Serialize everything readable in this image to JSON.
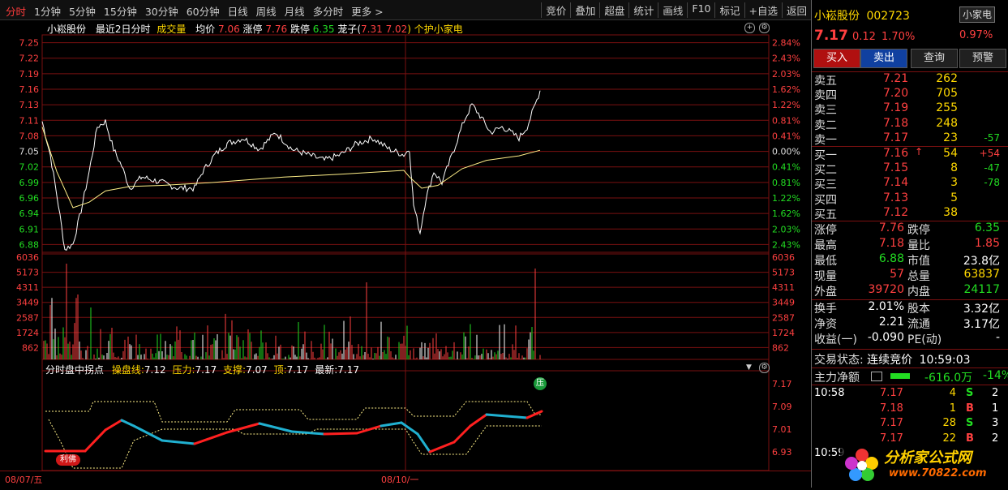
{
  "toolbar": {
    "periods": [
      "分时",
      "1分钟",
      "5分钟",
      "15分钟",
      "30分钟",
      "60分钟",
      "日线",
      "周线",
      "月线",
      "多分时",
      "更多 >"
    ],
    "tools": [
      "竞价",
      "叠加",
      "超盘",
      "统计",
      "画线",
      "F10",
      "标记",
      "+自选",
      "返回"
    ]
  },
  "chart_info": {
    "name": "小崧股份",
    "mode": "最近2日分时",
    "vol_label": "成交量",
    "avg_label": "均价",
    "avg": "7.06",
    "limit_up_label": "涨停",
    "limit_up": "7.76",
    "limit_down_label": "跌停",
    "limit_down": "6.35",
    "extra_label": "茏子(",
    "extra1": "7.31",
    "extra2": "7.02",
    "extra_tail": ") 个护小家电"
  },
  "axes": {
    "price_ticks": [
      "7.25",
      "7.22",
      "7.19",
      "7.16",
      "7.13",
      "7.11",
      "7.08",
      "7.05",
      "7.02",
      "6.99",
      "6.96",
      "6.94",
      "6.91",
      "6.88"
    ],
    "pct_ticks": [
      "2.84%",
      "2.43%",
      "2.03%",
      "1.62%",
      "1.22%",
      "0.81%",
      "0.41%",
      "0.00%",
      "0.41%",
      "0.81%",
      "1.22%",
      "1.62%",
      "2.03%",
      "2.43%"
    ],
    "vol_ticks": [
      "6036",
      "5173",
      "4311",
      "3449",
      "2587",
      "1724",
      "862"
    ],
    "ind_ticks": [
      "7.17",
      "7.09",
      "7.01",
      "6.93"
    ],
    "dates": [
      "08/07/五",
      "08/10/一"
    ]
  },
  "indicator": {
    "title": "分时盘中拐点",
    "line_label": "操盘线:",
    "line_value": "7.12",
    "pressure_label": "压力:",
    "pressure_value": "7.17",
    "support_label": "支撑:",
    "support_value": "7.07",
    "top_label": "顶:",
    "top_value": "7.17",
    "latest_label": "最新:",
    "latest_value": "7.17",
    "badge_buy": "利佛",
    "badge_pressure": "压"
  },
  "chart_data": {
    "type": "line",
    "series": [],
    "ylim": [
      6.88,
      7.25
    ],
    "grid": true
  },
  "panel": {
    "stock_name": "小崧股份",
    "stock_code": "002723",
    "sector": "小家电",
    "sector_pct": "0.97%",
    "price": "7.17",
    "change": "0.12",
    "change_pct": "1.70%",
    "buttons": [
      "买入",
      "卖出",
      "查询",
      "预警"
    ],
    "asks": [
      {
        "label": "卖五",
        "price": "7.21",
        "vol": "262",
        "diff": ""
      },
      {
        "label": "卖四",
        "price": "7.20",
        "vol": "705",
        "diff": ""
      },
      {
        "label": "卖三",
        "price": "7.19",
        "vol": "255",
        "diff": ""
      },
      {
        "label": "卖二",
        "price": "7.18",
        "vol": "248",
        "diff": ""
      },
      {
        "label": "卖一",
        "price": "7.17",
        "vol": "23",
        "diff": "-57"
      }
    ],
    "bids": [
      {
        "label": "买一",
        "price": "7.16",
        "vol": "54",
        "diff": "+54"
      },
      {
        "label": "买二",
        "price": "7.15",
        "vol": "8",
        "diff": "-47"
      },
      {
        "label": "买三",
        "price": "7.14",
        "vol": "3",
        "diff": "-78"
      },
      {
        "label": "买四",
        "price": "7.13",
        "vol": "5",
        "diff": ""
      },
      {
        "label": "买五",
        "price": "7.12",
        "vol": "38",
        "diff": ""
      }
    ],
    "stats": [
      {
        "l1": "涨停",
        "v1": "7.76",
        "l2": "跌停",
        "v2": "6.35"
      },
      {
        "l1": "最高",
        "v1": "7.18",
        "l2": "量比",
        "v2": "1.85"
      },
      {
        "l1": "最低",
        "v1": "6.88",
        "l2": "市值",
        "v2": "23.8亿"
      },
      {
        "l1": "现量",
        "v1": "57",
        "l2": "总量",
        "v2": "63837"
      },
      {
        "l1": "外盘",
        "v1": "39720",
        "l2": "内盘",
        "v2": "24117"
      }
    ],
    "stats2": [
      {
        "l1": "换手",
        "v1": "2.01%",
        "l2": "股本",
        "v2": "3.32亿"
      },
      {
        "l1": "净资",
        "v1": "2.21",
        "l2": "流通",
        "v2": "3.17亿"
      },
      {
        "l1": "收益(一)",
        "v1": "-0.090",
        "l2": "PE(动)",
        "v2": "-"
      }
    ],
    "trade_status_label": "交易状态:",
    "trade_status": "连续竞价",
    "trade_time": "10:59:03",
    "netflow_label": "主力净额",
    "netflow": "-616.0万",
    "netflow_pct": "-14%",
    "ticks": [
      {
        "time": "10:58",
        "price": "7.17",
        "vol": "4",
        "side": "S",
        "n": "2"
      },
      {
        "time": "",
        "price": "7.18",
        "vol": "1",
        "side": "B",
        "n": "1"
      },
      {
        "time": "",
        "price": "7.17",
        "vol": "28",
        "side": "S",
        "n": "3"
      },
      {
        "time": "",
        "price": "7.17",
        "vol": "22",
        "side": "B",
        "n": "2"
      },
      {
        "time": "10:59",
        "price": "",
        "vol": "",
        "side": "",
        "n": ""
      }
    ]
  }
}
